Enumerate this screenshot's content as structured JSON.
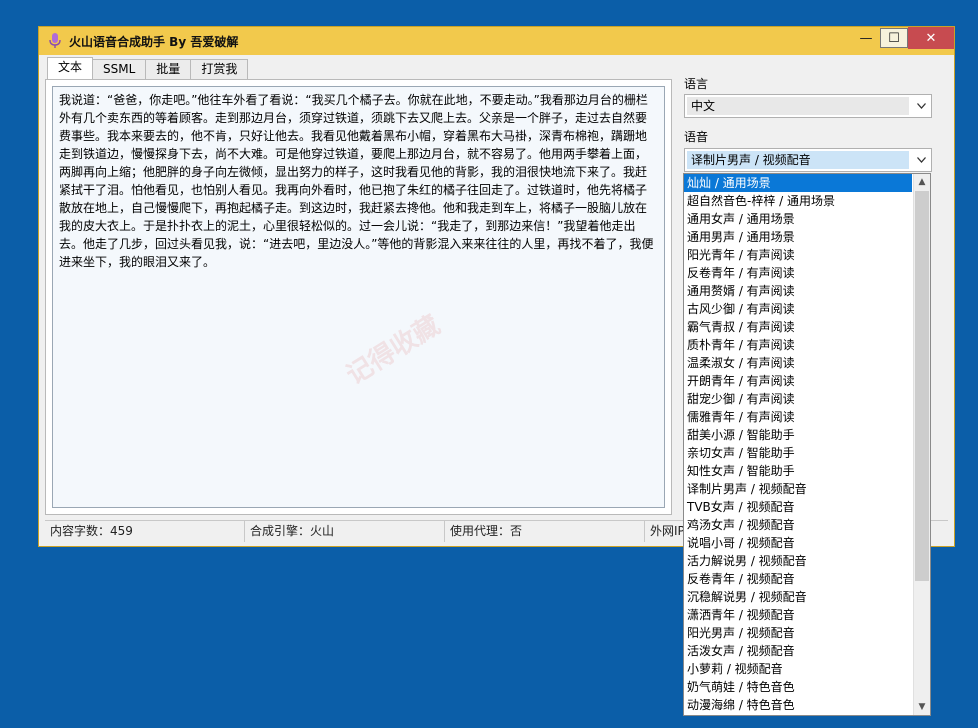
{
  "window": {
    "title": "火山语音合成助手 By 吾爱破解",
    "minimize": "—",
    "maximize": "☐",
    "close": "✕"
  },
  "tabs": [
    "文本",
    "SSML",
    "批量",
    "打赏我"
  ],
  "editor": {
    "text": "我说道：“爸爸，你走吧。”他往车外看了看说：“我买几个橘子去。你就在此地，不要走动。”我看那边月台的栅栏外有几个卖东西的等着顾客。走到那边月台，须穿过铁道，须跳下去又爬上去。父亲是一个胖子，走过去自然要费事些。我本来要去的，他不肯，只好让他去。我看见他戴着黑布小帽，穿着黑布大马褂，深青布棉袍，蹒跚地走到铁道边，慢慢探身下去，尚不大难。可是他穿过铁道，要爬上那边月台，就不容易了。他用两手攀着上面，两脚再向上缩；他肥胖的身子向左微倾，显出努力的样子，这时我看见他的背影，我的泪很快地流下来了。我赶紧拭干了泪。怕他看见，也怕别人看见。我再向外看时，他已抱了朱红的橘子往回走了。过铁道时，他先将橘子散放在地上，自己慢慢爬下，再抱起橘子走。到这边时，我赶紧去搀他。他和我走到车上，将橘子一股脑儿放在我的皮大衣上。于是扑扑衣上的泥土，心里很轻松似的。过一会儿说：“我走了，到那边来信！”我望着他走出去。他走了几步，回过头看见我，说：“进去吧，里边没人。”等他的背影混入来来往往的人里，再找不着了，我便进来坐下，我的眼泪又来了。"
  },
  "status": {
    "char_count": "内容字数：459",
    "engine": "合成引擎：火山",
    "proxy": "使用代理：否",
    "public_ip": "外网IP"
  },
  "settings": {
    "language_label": "语言",
    "language_value": "中文",
    "voice_label": "语音",
    "voice_value": "译制片男声 / 视频配音"
  },
  "voice_options": [
    "灿灿 / 通用场景",
    "超自然音色-梓梓 / 通用场景",
    "通用女声 / 通用场景",
    "通用男声 / 通用场景",
    "阳光青年 / 有声阅读",
    "反卷青年 / 有声阅读",
    "通用赘婿 / 有声阅读",
    "古风少御 / 有声阅读",
    "霸气青叔 / 有声阅读",
    "质朴青年 / 有声阅读",
    "温柔淑女 / 有声阅读",
    "开朗青年 / 有声阅读",
    "甜宠少御 / 有声阅读",
    "儒雅青年 / 有声阅读",
    "甜美小源 / 智能助手",
    "亲切女声 / 智能助手",
    "知性女声 / 智能助手",
    "译制片男声 / 视频配音",
    "TVB女声 / 视频配音",
    "鸡汤女声 / 视频配音",
    "说唱小哥 / 视频配音",
    "活力解说男 / 视频配音",
    "反卷青年 / 视频配音",
    "沉稳解说男 / 视频配音",
    "潇洒青年 / 视频配音",
    "阳光男声 / 视频配音",
    "活泼女声 / 视频配音",
    "小萝莉 / 视频配音",
    "奶气萌娃 / 特色音色",
    "动漫海绵 / 特色音色"
  ],
  "watermark": "记得收藏"
}
